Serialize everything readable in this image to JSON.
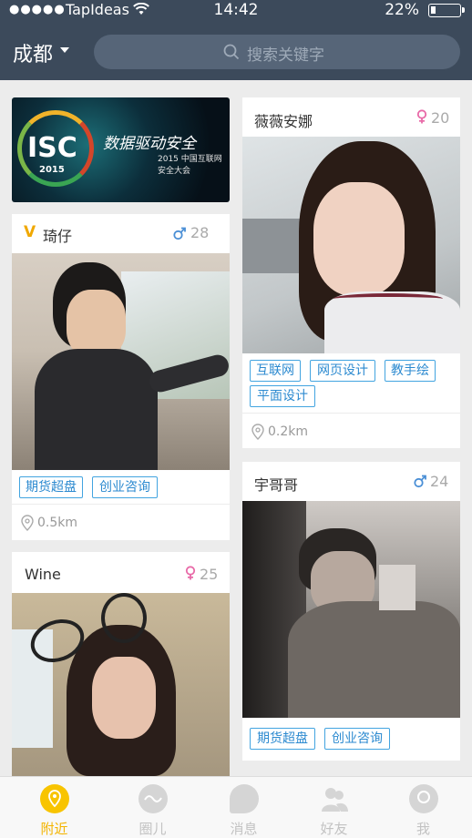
{
  "status_bar": {
    "dots": "●●●●●",
    "carrier": "TapIdeas",
    "time": "14:42",
    "battery": "22%"
  },
  "header": {
    "city": "成都",
    "search_placeholder": "搜索关键字"
  },
  "banner": {
    "logo": "ISC",
    "year": "2015",
    "title": "数据驱动安全",
    "subtitle": "2015 中国互联网安全大会"
  },
  "cards": [
    {
      "name": "琦仔",
      "age": "28",
      "gender": "male",
      "verified": "V",
      "tags": [
        "期货超盘",
        "创业咨询"
      ],
      "distance": "0.5km"
    },
    {
      "name": "Wine",
      "age": "25",
      "gender": "female"
    },
    {
      "name": "薇薇安娜",
      "age": "20",
      "gender": "female",
      "tags": [
        "互联网",
        "网页设计",
        "教手绘",
        "平面设计"
      ],
      "distance": "0.2km"
    },
    {
      "name": "宇哥哥",
      "age": "24",
      "gender": "male",
      "tags": [
        "期货超盘",
        "创业咨询"
      ]
    }
  ],
  "tabs": [
    {
      "label": "附近",
      "icon": "location-icon",
      "active": true
    },
    {
      "label": "圈儿",
      "icon": "circle-wave-icon",
      "active": false
    },
    {
      "label": "消息",
      "icon": "chat-bubble-icon",
      "active": false
    },
    {
      "label": "好友",
      "icon": "friends-icon",
      "active": false
    },
    {
      "label": "我",
      "icon": "user-icon",
      "active": false
    }
  ],
  "colors": {
    "header": "#3c4a5b",
    "tag_border": "#42a4e0",
    "male": "#4a8fd6",
    "female": "#e86aa8",
    "active_tab": "#f8c400"
  }
}
